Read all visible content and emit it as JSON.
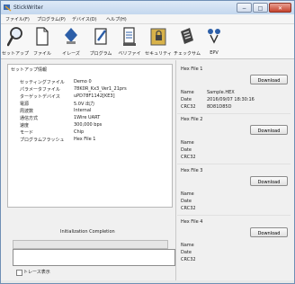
{
  "window": {
    "title": "StickWriter",
    "buttons": {
      "minimize": "−",
      "maximize": "□",
      "close": "✕"
    }
  },
  "menu": [
    "ファイル(F)",
    "プログラム(P)",
    "デバイス(D)",
    "ヘルプ(H)"
  ],
  "toolbar": [
    {
      "label": "セットアップ",
      "icon": "magnifier-icon"
    },
    {
      "label": "ファイル",
      "icon": "file-icon"
    },
    {
      "label": "イレーズ",
      "icon": "erase-icon"
    },
    {
      "label": "プログラム",
      "icon": "program-icon"
    },
    {
      "label": "ベリファイ",
      "icon": "verify-icon"
    },
    {
      "label": "セキュリティ",
      "icon": "lock-icon"
    },
    {
      "label": "チェックサム",
      "icon": "calculator-icon"
    },
    {
      "label": "EPV",
      "icon": "epv-icon"
    }
  ],
  "setup": {
    "title": "セットアップ情報",
    "rows": [
      {
        "key": "セッティングファイル",
        "value": "Demo 0"
      },
      {
        "key": "パラメータファイル",
        "value": "78K0R_Kx3_Ver1_21prs"
      },
      {
        "key": "ターゲットデバイス",
        "value": "uPD78F1142[KE3]"
      },
      {
        "key": "電源",
        "value": "5.0V 出力"
      },
      {
        "key": "周波数",
        "value": "Internal"
      },
      {
        "key": "通信方式",
        "value": "1Wire UART"
      },
      {
        "key": "速度",
        "value": "300,000 bps"
      },
      {
        "key": "モード",
        "value": "Chip"
      },
      {
        "key": "プログラムフラッシュ",
        "value": "Hex File 1"
      }
    ]
  },
  "status": {
    "init_label": "Initialization Completion",
    "trace_label": "トレース表示",
    "trace_checked": false
  },
  "hex_files": [
    {
      "title": "Hex File 1",
      "button": "Download",
      "labels": {
        "name": "Name",
        "date": "Date",
        "crc": "CRC32"
      },
      "name": "Sample.HEX",
      "date": "2016/09/07 18:30:16",
      "crc": "8D81D85D"
    },
    {
      "title": "Hex File 2",
      "button": "Download",
      "labels": {
        "name": "Name",
        "date": "Date",
        "crc": "CRC32"
      },
      "name": "",
      "date": "",
      "crc": ""
    },
    {
      "title": "Hex File 3",
      "button": "Download",
      "labels": {
        "name": "Name",
        "date": "Date",
        "crc": "CRC32"
      },
      "name": "",
      "date": "",
      "crc": ""
    },
    {
      "title": "Hex File 4",
      "button": "Download",
      "labels": {
        "name": "Name",
        "date": "Date",
        "crc": "CRC32"
      },
      "name": "",
      "date": "",
      "crc": ""
    }
  ]
}
